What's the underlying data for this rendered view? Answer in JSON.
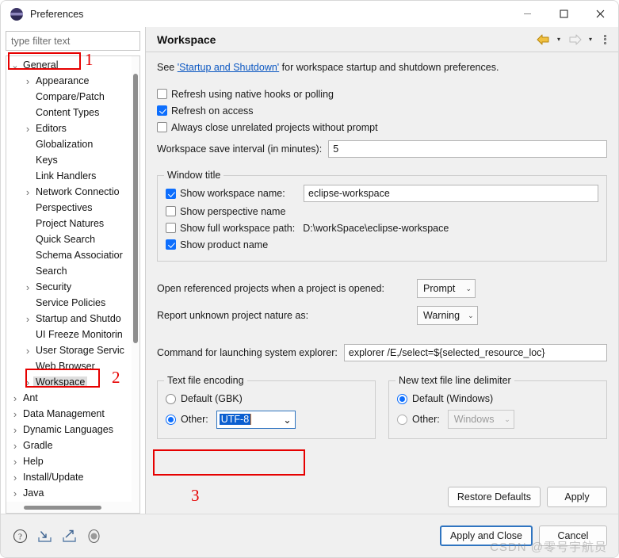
{
  "window": {
    "title": "Preferences",
    "icon": "eclipse-icon",
    "controls": {
      "minimize": "—",
      "maximize": "☐",
      "close": "✕"
    }
  },
  "sidebar": {
    "filter_placeholder": "type filter text",
    "filter_value": "",
    "items": [
      {
        "label": "General",
        "level": 1,
        "twisty": "down",
        "selected": false
      },
      {
        "label": "Appearance",
        "level": 2,
        "twisty": "right",
        "selected": false
      },
      {
        "label": "Compare/Patch",
        "level": 2,
        "twisty": "none",
        "selected": false
      },
      {
        "label": "Content Types",
        "level": 2,
        "twisty": "none",
        "selected": false
      },
      {
        "label": "Editors",
        "level": 2,
        "twisty": "right",
        "selected": false
      },
      {
        "label": "Globalization",
        "level": 2,
        "twisty": "none",
        "selected": false
      },
      {
        "label": "Keys",
        "level": 2,
        "twisty": "none",
        "selected": false
      },
      {
        "label": "Link Handlers",
        "level": 2,
        "twisty": "none",
        "selected": false
      },
      {
        "label": "Network Connectio",
        "level": 2,
        "twisty": "right",
        "selected": false
      },
      {
        "label": "Perspectives",
        "level": 2,
        "twisty": "none",
        "selected": false
      },
      {
        "label": "Project Natures",
        "level": 2,
        "twisty": "none",
        "selected": false
      },
      {
        "label": "Quick Search",
        "level": 2,
        "twisty": "none",
        "selected": false
      },
      {
        "label": "Schema Associatior",
        "level": 2,
        "twisty": "none",
        "selected": false
      },
      {
        "label": "Search",
        "level": 2,
        "twisty": "none",
        "selected": false
      },
      {
        "label": "Security",
        "level": 2,
        "twisty": "right",
        "selected": false
      },
      {
        "label": "Service Policies",
        "level": 2,
        "twisty": "none",
        "selected": false
      },
      {
        "label": "Startup and Shutdo",
        "level": 2,
        "twisty": "right",
        "selected": false
      },
      {
        "label": "UI Freeze Monitorin",
        "level": 2,
        "twisty": "none",
        "selected": false
      },
      {
        "label": "User Storage Servic",
        "level": 2,
        "twisty": "right",
        "selected": false
      },
      {
        "label": "Web Browser",
        "level": 2,
        "twisty": "none",
        "selected": false
      },
      {
        "label": "Workspace",
        "level": 2,
        "twisty": "right",
        "selected": true
      },
      {
        "label": "Ant",
        "level": 1,
        "twisty": "right",
        "selected": false
      },
      {
        "label": "Data Management",
        "level": 1,
        "twisty": "right",
        "selected": false
      },
      {
        "label": "Dynamic Languages",
        "level": 1,
        "twisty": "right",
        "selected": false
      },
      {
        "label": "Gradle",
        "level": 1,
        "twisty": "right",
        "selected": false
      },
      {
        "label": "Help",
        "level": 1,
        "twisty": "right",
        "selected": false
      },
      {
        "label": "Install/Update",
        "level": 1,
        "twisty": "right",
        "selected": false
      },
      {
        "label": "Java",
        "level": 1,
        "twisty": "right",
        "selected": false
      }
    ]
  },
  "content": {
    "title": "Workspace",
    "toolbar": {
      "back": "back-arrow-icon",
      "back_menu": "▾",
      "forward": "forward-arrow-icon",
      "forward_menu": "▾",
      "overflow": "view-menu-icon"
    },
    "intro": {
      "prefix": "See ",
      "link": "'Startup and Shutdown'",
      "suffix": " for workspace startup and shutdown preferences."
    },
    "checkboxes": [
      {
        "label": "Refresh using native hooks or polling",
        "checked": false,
        "mnemonic": "R"
      },
      {
        "label": "Refresh on access",
        "checked": true,
        "mnemonic": "s"
      },
      {
        "label": "Always close unrelated projects without prompt",
        "checked": false,
        "mnemonic": "c"
      }
    ],
    "save_interval": {
      "label": "Workspace save interval (in minutes):",
      "value": "5"
    },
    "window_title_group": {
      "legend": "Window title",
      "show_workspace_name": {
        "label": "Show workspace name:",
        "checked": true,
        "value": "eclipse-workspace"
      },
      "show_perspective_name": {
        "label": "Show perspective name",
        "checked": false
      },
      "show_full_workspace_path": {
        "label": "Show full workspace path:",
        "checked": false,
        "value": "D:\\workSpace\\eclipse-workspace"
      },
      "show_product_name": {
        "label": "Show product name",
        "checked": true
      }
    },
    "open_referenced": {
      "label": "Open referenced projects when a project is opened:",
      "value": "Prompt"
    },
    "report_unknown_nature": {
      "label": "Report unknown project nature as:",
      "value": "Warning"
    },
    "system_explorer": {
      "label": "Command for launching system explorer:",
      "value": "explorer /E,/select=${selected_resource_loc}"
    },
    "text_file_encoding": {
      "legend": "Text file encoding",
      "default_label": "Default (GBK)",
      "default_selected": false,
      "other_label": "Other:",
      "other_selected": true,
      "other_value": "UTF-8"
    },
    "line_delimiter": {
      "legend": "New text file line delimiter",
      "default_label": "Default (Windows)",
      "default_selected": true,
      "other_label": "Other:",
      "other_selected": false,
      "other_value": "Windows",
      "other_disabled": true
    },
    "restore_defaults_label": "Restore Defaults",
    "apply_label": "Apply"
  },
  "footer": {
    "icons": [
      "help-icon",
      "import-icon",
      "export-icon",
      "record-icon"
    ],
    "apply_and_close_label": "Apply and Close",
    "cancel_label": "Cancel",
    "watermark": "CSDN @零号宇航员"
  },
  "annotations": [
    {
      "number": "1",
      "target": "general-tree-item"
    },
    {
      "number": "2",
      "target": "workspace-tree-item"
    },
    {
      "number": "3",
      "target": "other-encoding-row"
    }
  ],
  "colors": {
    "accent": "#0d6efd",
    "link": "#0b57c2",
    "annotation_red": "#e60000",
    "back_arrow": "#e6a817",
    "forward_arrow": "#c9c9c9"
  }
}
